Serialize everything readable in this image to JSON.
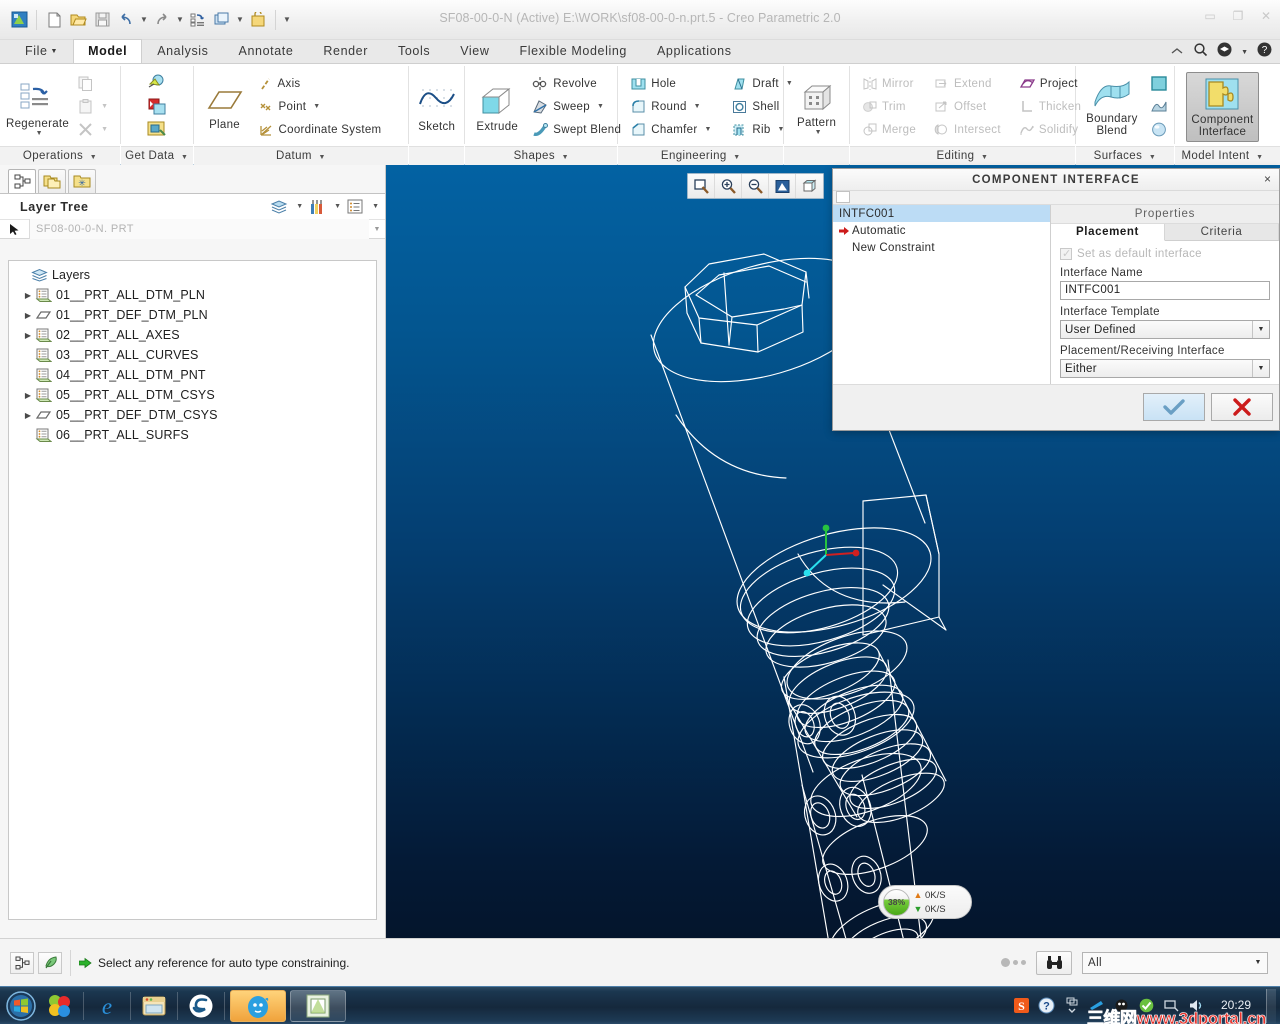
{
  "titlebar": {
    "title": "SF08-00-0-N (Active) E:\\WORK\\sf08-00-0-n.prt.5 - Creo Parametric 2.0",
    "quick_access": [
      {
        "name": "creo-logo-icon",
        "label": "Creo"
      },
      {
        "name": "new-file-icon",
        "label": "New"
      },
      {
        "name": "open-file-icon",
        "label": "Open"
      },
      {
        "name": "save-icon",
        "label": "Save"
      },
      {
        "name": "undo-icon",
        "label": "Undo"
      },
      {
        "name": "redo-icon",
        "label": "Redo"
      },
      {
        "name": "regenerate-icon",
        "label": "Regenerate"
      },
      {
        "name": "window-icon",
        "label": "Window"
      },
      {
        "name": "close-window-icon",
        "label": "Close"
      },
      {
        "name": "customize-qat-icon",
        "label": "Customize Quick Access Toolbar"
      }
    ],
    "window_buttons": [
      "minimize",
      "restore",
      "close"
    ]
  },
  "tabs": {
    "items": [
      {
        "label": "File",
        "caret": true,
        "active": false
      },
      {
        "label": "Model",
        "caret": false,
        "active": true
      },
      {
        "label": "Analysis",
        "caret": false,
        "active": false
      },
      {
        "label": "Annotate",
        "caret": false,
        "active": false
      },
      {
        "label": "Render",
        "caret": false,
        "active": false
      },
      {
        "label": "Tools",
        "caret": false,
        "active": false
      },
      {
        "label": "View",
        "caret": false,
        "active": false
      },
      {
        "label": "Flexible Modeling",
        "caret": false,
        "active": false
      },
      {
        "label": "Applications",
        "caret": false,
        "active": false
      }
    ],
    "right_icons": [
      {
        "name": "minimize-ribbon-icon"
      },
      {
        "name": "search-icon"
      },
      {
        "name": "learning-connector-icon"
      },
      {
        "name": "chevron-down-icon"
      },
      {
        "name": "help-icon"
      }
    ]
  },
  "ribbon": {
    "groups": [
      {
        "label": "Operations",
        "big": [
          {
            "label": "Regenerate",
            "icon": "regenerate-icon",
            "dropdown": true,
            "disabled": false
          }
        ],
        "small": [
          {
            "label": "",
            "icon": "copy-icon",
            "disabled": true,
            "dropdown": false
          },
          {
            "label": "",
            "icon": "paste-icon",
            "disabled": true,
            "dropdown": true
          },
          {
            "label": "",
            "icon": "delete-icon",
            "disabled": true,
            "dropdown": true
          }
        ]
      },
      {
        "label": "Get Data",
        "small": [
          {
            "label": "",
            "icon": "import-icon",
            "disabled": false
          },
          {
            "label": "",
            "icon": "merge-inherit-icon",
            "disabled": false
          },
          {
            "label": "",
            "icon": "shrinkwrap-icon",
            "disabled": false
          }
        ]
      },
      {
        "label": "Datum",
        "big": [
          {
            "label": "Plane",
            "icon": "plane-icon",
            "dropdown": false,
            "disabled": false
          }
        ],
        "small": [
          {
            "label": "Axis",
            "icon": "axis-icon",
            "disabled": false,
            "dropdown": false
          },
          {
            "label": "Point",
            "icon": "point-icon",
            "disabled": false,
            "dropdown": true
          },
          {
            "label": "Coordinate System",
            "icon": "coordinate-system-icon",
            "disabled": false,
            "dropdown": false
          }
        ]
      },
      {
        "label": "",
        "big": [
          {
            "label": "Sketch",
            "icon": "sketch-icon",
            "dropdown": false,
            "disabled": false
          }
        ]
      },
      {
        "label": "Shapes",
        "big": [
          {
            "label": "Extrude",
            "icon": "extrude-icon",
            "dropdown": false,
            "disabled": false
          }
        ],
        "small": [
          {
            "label": "Revolve",
            "icon": "revolve-icon",
            "disabled": false,
            "dropdown": false
          },
          {
            "label": "Sweep",
            "icon": "sweep-icon",
            "disabled": false,
            "dropdown": true
          },
          {
            "label": "Swept Blend",
            "icon": "swept-blend-icon",
            "disabled": false,
            "dropdown": false
          }
        ]
      },
      {
        "label": "Engineering",
        "small_a": [
          {
            "label": "Hole",
            "icon": "hole-icon",
            "disabled": false,
            "dropdown": false
          },
          {
            "label": "Round",
            "icon": "round-icon",
            "disabled": false,
            "dropdown": true
          },
          {
            "label": "Chamfer",
            "icon": "chamfer-icon",
            "disabled": false,
            "dropdown": true
          }
        ],
        "small_b": [
          {
            "label": "Draft",
            "icon": "draft-icon",
            "disabled": false,
            "dropdown": true
          },
          {
            "label": "Shell",
            "icon": "shell-icon",
            "disabled": false,
            "dropdown": false
          },
          {
            "label": "Rib",
            "icon": "rib-icon",
            "disabled": false,
            "dropdown": true
          }
        ]
      },
      {
        "label": "",
        "big": [
          {
            "label": "Pattern",
            "icon": "pattern-icon",
            "dropdown": true,
            "disabled": false
          }
        ]
      },
      {
        "label": "Editing",
        "small_a": [
          {
            "label": "Mirror",
            "icon": "mirror-icon",
            "disabled": true,
            "dropdown": false
          },
          {
            "label": "Trim",
            "icon": "trim-icon",
            "disabled": true,
            "dropdown": false
          },
          {
            "label": "Merge",
            "icon": "merge-icon",
            "disabled": true,
            "dropdown": false
          }
        ],
        "small_b": [
          {
            "label": "Extend",
            "icon": "extend-icon",
            "disabled": true,
            "dropdown": false
          },
          {
            "label": "Offset",
            "icon": "offset-icon",
            "disabled": true,
            "dropdown": false
          },
          {
            "label": "Intersect",
            "icon": "intersect-icon",
            "disabled": true,
            "dropdown": false
          }
        ],
        "small_c": [
          {
            "label": "Project",
            "icon": "project-icon",
            "disabled": false,
            "dropdown": false
          },
          {
            "label": "Thicken",
            "icon": "thicken-icon",
            "disabled": true,
            "dropdown": false
          },
          {
            "label": "Solidify",
            "icon": "solidify-icon",
            "disabled": true,
            "dropdown": false
          }
        ]
      },
      {
        "label": "Surfaces",
        "big": [
          {
            "label": "Boundary\nBlend",
            "icon": "boundary-blend-icon",
            "dropdown": false,
            "disabled": false
          }
        ],
        "small": [
          {
            "label": "",
            "icon": "fill-surface-icon",
            "disabled": false
          },
          {
            "label": "",
            "icon": "style-surface-icon",
            "disabled": false
          },
          {
            "label": "",
            "icon": "freestyle-icon",
            "disabled": false
          }
        ]
      },
      {
        "label": "Model Intent",
        "big": [
          {
            "label": "Component\nInterface",
            "icon": "component-interface-icon",
            "dropdown": false,
            "selected": true
          }
        ]
      }
    ]
  },
  "left_panel": {
    "panel_tabs": [
      {
        "name": "model-tree-tab",
        "active": true
      },
      {
        "name": "folder-browser-tab",
        "active": false
      },
      {
        "name": "favorites-tab",
        "active": false
      }
    ],
    "header_title": "Layer Tree",
    "header_tools": [
      {
        "name": "show-layers-icon",
        "dropdown": true
      },
      {
        "name": "settings-tools-icon",
        "dropdown": true
      },
      {
        "name": "tree-display-icon",
        "dropdown": true
      }
    ],
    "filter_value": "SF08-00-0-N. PRT",
    "tree": {
      "root": {
        "label": "Layers",
        "icon": "layers-icon"
      },
      "items": [
        {
          "label": "01__PRT_ALL_DTM_PLN",
          "icon": "layer-icon",
          "expandable": true
        },
        {
          "label": "01__PRT_DEF_DTM_PLN",
          "icon": "plane-layer-icon",
          "expandable": true
        },
        {
          "label": "02__PRT_ALL_AXES",
          "icon": "layer-icon",
          "expandable": true
        },
        {
          "label": "03__PRT_ALL_CURVES",
          "icon": "layer-icon",
          "expandable": false
        },
        {
          "label": "04__PRT_ALL_DTM_PNT",
          "icon": "layer-icon",
          "expandable": false
        },
        {
          "label": "05__PRT_ALL_DTM_CSYS",
          "icon": "layer-icon",
          "expandable": true
        },
        {
          "label": "05__PRT_DEF_DTM_CSYS",
          "icon": "plane-layer-icon",
          "expandable": true
        },
        {
          "label": "06__PRT_ALL_SURFS",
          "icon": "layer-icon",
          "expandable": false
        }
      ]
    }
  },
  "viewport": {
    "graphics_toolbar": [
      {
        "name": "refit-icon"
      },
      {
        "name": "zoom-in-icon"
      },
      {
        "name": "zoom-out-icon"
      },
      {
        "name": "repaint-icon"
      },
      {
        "name": "display-style-icon"
      }
    ],
    "background_top_color": "#0362a3",
    "background_bottom_color": "#04152c",
    "wireframe_color": "#ffffff"
  },
  "network_widget": {
    "percent": "38%",
    "upload": "0K/S",
    "download": "0K/S"
  },
  "dialog": {
    "title": "COMPONENT INTERFACE",
    "close_label": "×",
    "list": [
      {
        "label": "INTFC001",
        "selected": true,
        "icon": null
      },
      {
        "label": "Automatic",
        "selected": false,
        "icon": "red-arrow-icon"
      },
      {
        "label": "New Constraint",
        "selected": false,
        "icon": null
      }
    ],
    "properties_header": "Properties",
    "tabs": [
      {
        "label": "Placement",
        "active": true
      },
      {
        "label": "Criteria",
        "active": false
      }
    ],
    "checkbox": {
      "label": "Set as default interface",
      "checked": true,
      "disabled": true
    },
    "fields": [
      {
        "label": "Interface Name",
        "type": "input",
        "value": "INTFC001"
      },
      {
        "label": "Interface Template",
        "type": "select",
        "value": "User Defined"
      },
      {
        "label": "Placement/Receiving Interface",
        "type": "select",
        "value": "Either"
      }
    ],
    "buttons": [
      {
        "name": "ok-button",
        "glyph": "✓"
      },
      {
        "name": "cancel-button",
        "glyph": "✕"
      }
    ]
  },
  "statusbar": {
    "left_icons": [
      {
        "name": "model-tree-toggle-icon"
      },
      {
        "name": "feather-annotate-icon"
      }
    ],
    "message": "Select any reference for auto type constraining.",
    "message_icon": "green-arrow-icon",
    "search_icon": "binoculars-icon",
    "selection_filter": "All"
  },
  "taskbar": {
    "start_label": "Start",
    "pinned": [
      {
        "name": "taskbar-colors-icon"
      },
      {
        "name": "taskbar-ie-icon"
      },
      {
        "name": "taskbar-explorer-icon"
      },
      {
        "name": "taskbar-sogou-icon"
      }
    ],
    "windows": [
      {
        "name": "taskbar-window-qq",
        "active": true
      },
      {
        "name": "taskbar-window-creo",
        "active": false
      }
    ],
    "tray": [
      {
        "name": "tray-sogou-icon"
      },
      {
        "name": "tray-help-icon"
      },
      {
        "name": "tray-expand-icon"
      },
      {
        "name": "tray-network-icon"
      },
      {
        "name": "tray-security-icon"
      },
      {
        "name": "tray-shield-icon"
      },
      {
        "name": "tray-monitor-icon"
      },
      {
        "name": "tray-volume-icon"
      }
    ],
    "clock": "20:29"
  },
  "watermark": {
    "text": "三维网www.3dportal.cn"
  }
}
